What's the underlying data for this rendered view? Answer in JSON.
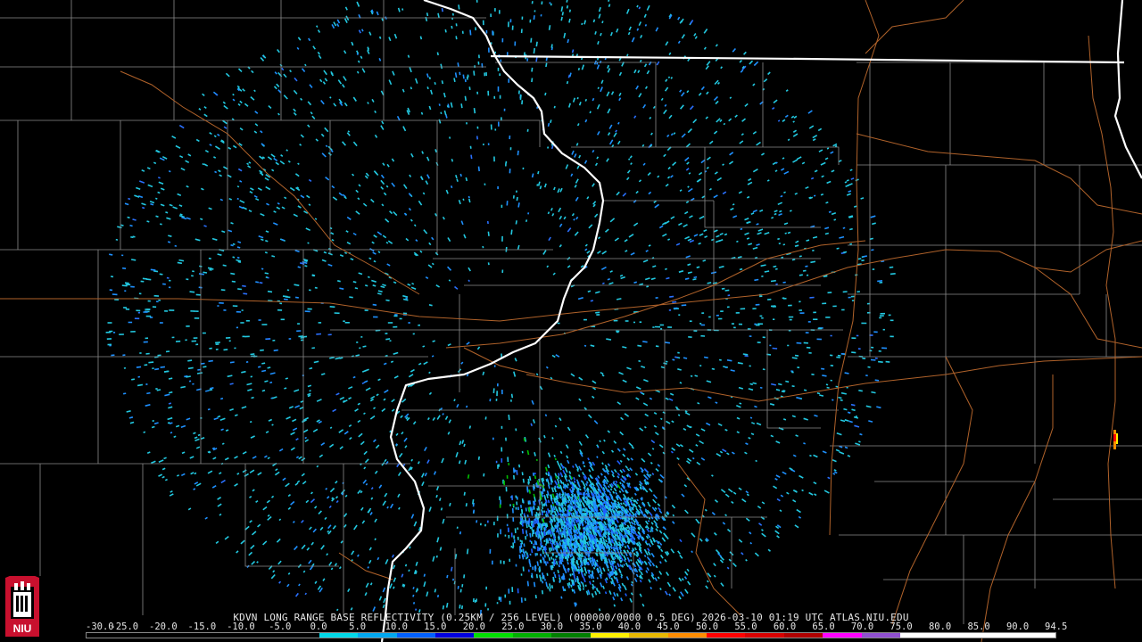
{
  "caption": "KDVN LONG RANGE BASE REFLECTIVITY (0.25KM / 256 LEVEL) (000000/0000 0.5 DEG) 2026-03-10 01:19 UTC  ATLAS.NIU.EDU",
  "logo": {
    "text": "NIU",
    "name": "niu-logo"
  },
  "legend": {
    "ticks": [
      "-30.0",
      "-25.0",
      "-20.0",
      "-15.0",
      "-10.0",
      "-5.0",
      "0.0",
      "5.0",
      "10.0",
      "15.0",
      "20.0",
      "25.0",
      "30.0",
      "35.0",
      "40.0",
      "45.0",
      "50.0",
      "55.0",
      "60.0",
      "65.0",
      "70.0",
      "75.0",
      "80.0",
      "85.0",
      "90.0",
      "94.5"
    ],
    "colors": [
      "#000000",
      "#000000",
      "#000000",
      "#000000",
      "#000000",
      "#000000",
      "#00d8e8",
      "#00a8f0",
      "#0060ff",
      "#0000e0",
      "#00e000",
      "#00b000",
      "#008000",
      "#fff000",
      "#e8b800",
      "#ff8c00",
      "#ff0000",
      "#d80000",
      "#b00000",
      "#ff00ff",
      "#9050d0",
      "#ffffff",
      "#ffffff",
      "#ffffff",
      "#ffffff"
    ]
  },
  "colors": {
    "state_border": "#ffffff",
    "county_border": "#8a8a8a",
    "highway": "#b0622a",
    "echo_light": "#22c8e0",
    "echo_mid": "#1e90ff",
    "echo_heavy": "#1f5fff"
  }
}
